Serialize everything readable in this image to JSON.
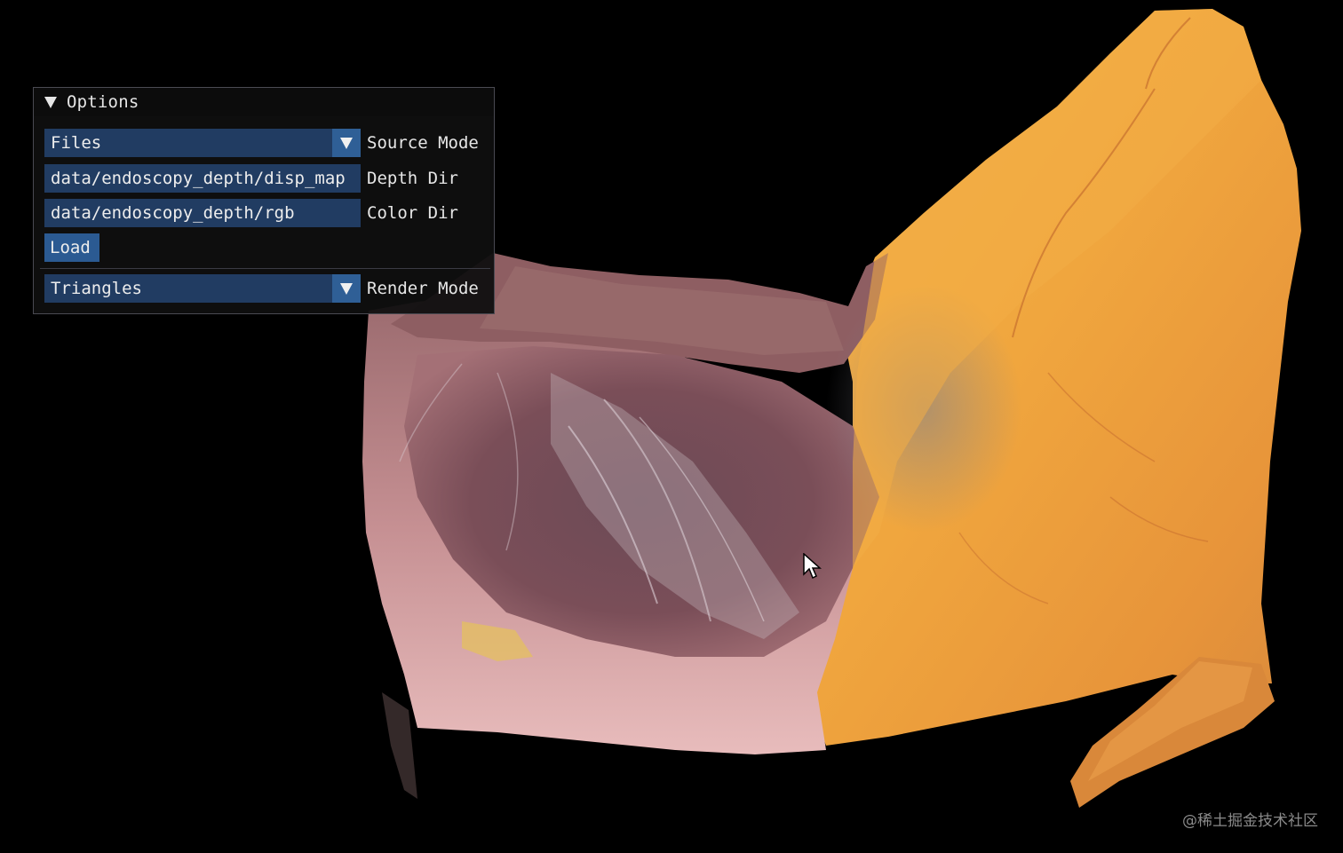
{
  "options_panel": {
    "title": "Options",
    "source_mode": {
      "value": "Files",
      "label": "Source Mode"
    },
    "depth_dir": {
      "value": "data/endoscopy_depth/disp_map",
      "label": "Depth Dir"
    },
    "color_dir": {
      "value": "data/endoscopy_depth/rgb",
      "label": "Color Dir"
    },
    "load_button": "Load",
    "render_mode": {
      "value": "Triangles",
      "label": "Render Mode"
    }
  },
  "watermark": "@稀土掘金技术社区",
  "colors": {
    "background": "#000000",
    "panel_bg": "#0f0f0f",
    "frame_bg": "#213c62",
    "button_bg": "#2b5a92",
    "tissue_orange": "#f2a33c",
    "tissue_pink": "#b98a90"
  },
  "icons": {
    "collapse": "triangle-down-icon",
    "combo": "chevron-down-icon",
    "cursor": "mouse-pointer-icon"
  }
}
